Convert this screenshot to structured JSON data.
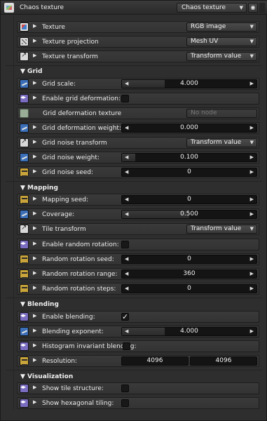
{
  "header": {
    "title": "Chaos texture",
    "node_type": "Chaos texture",
    "eye_symbol": "◉"
  },
  "rows_top": [
    {
      "label": "Texture",
      "value": "RGB image"
    },
    {
      "label": "Texture projection",
      "value": "Mesh UV"
    },
    {
      "label": "Texture transform",
      "value": "Transform value"
    }
  ],
  "grid": {
    "section_label": "▼ Grid",
    "grid_scale": {
      "label": "Grid scale:",
      "value": "4.000"
    },
    "enable_deform": {
      "label": "Enable grid deformation:"
    },
    "deform_texture": {
      "label": "Grid deformation texture",
      "value": "No node"
    },
    "deform_weight": {
      "label": "Grid deformation weight:",
      "value": "0.000"
    },
    "noise_transform": {
      "label": "Grid noise transform",
      "value": "Transform value"
    },
    "noise_weight": {
      "label": "Grid noise weight:",
      "value": "0.100"
    },
    "noise_seed": {
      "label": "Grid noise seed:",
      "value": "0"
    }
  },
  "mapping": {
    "section_label": "▼ Mapping",
    "mapping_seed": {
      "label": "Mapping seed:",
      "value": "0"
    },
    "coverage": {
      "label": "Coverage:",
      "value": "0.500"
    },
    "tile_transform": {
      "label": "Tile transform",
      "value": "Transform value"
    },
    "enable_random_rotation": {
      "label": "Enable random rotation:"
    },
    "random_rotation_seed": {
      "label": "Random rotation seed:",
      "value": "0"
    },
    "random_rotation_range": {
      "label": "Random rotation range:",
      "value": "360"
    },
    "random_rotation_steps": {
      "label": "Random rotation steps:",
      "value": "0"
    }
  },
  "blending": {
    "section_label": "▼ Blending",
    "enable_blending": {
      "label": "Enable blending:",
      "check": "✓"
    },
    "blending_exponent": {
      "label": "Blending exponent:",
      "value": "4.000"
    },
    "histogram_invariant": {
      "label": "Histogram invariant blending:"
    },
    "resolution": {
      "label": "Resolution:",
      "x": "4096",
      "y": "4096"
    }
  },
  "visualization": {
    "section_label": "▼ Visualization",
    "show_tile_structure": {
      "label": "Show tile structure:"
    },
    "show_hex_tiling": {
      "label": "Show hexagonal tiling:"
    }
  },
  "glyphs": {
    "expand": "▶",
    "dropdown": "▼",
    "left": "◀",
    "right": "▶"
  },
  "slider_fills": {
    "grid_scale": 0.32,
    "deform_weight": 0.0,
    "noise_weight": 0.1,
    "coverage": 0.5,
    "blending_exponent": 0.32
  },
  "colors": {
    "float_icon": "#3b6fb8",
    "bool_icon": "#7a6cc0",
    "int_icon": "#c9a43a",
    "panel_bg": "#2e2e2e"
  }
}
